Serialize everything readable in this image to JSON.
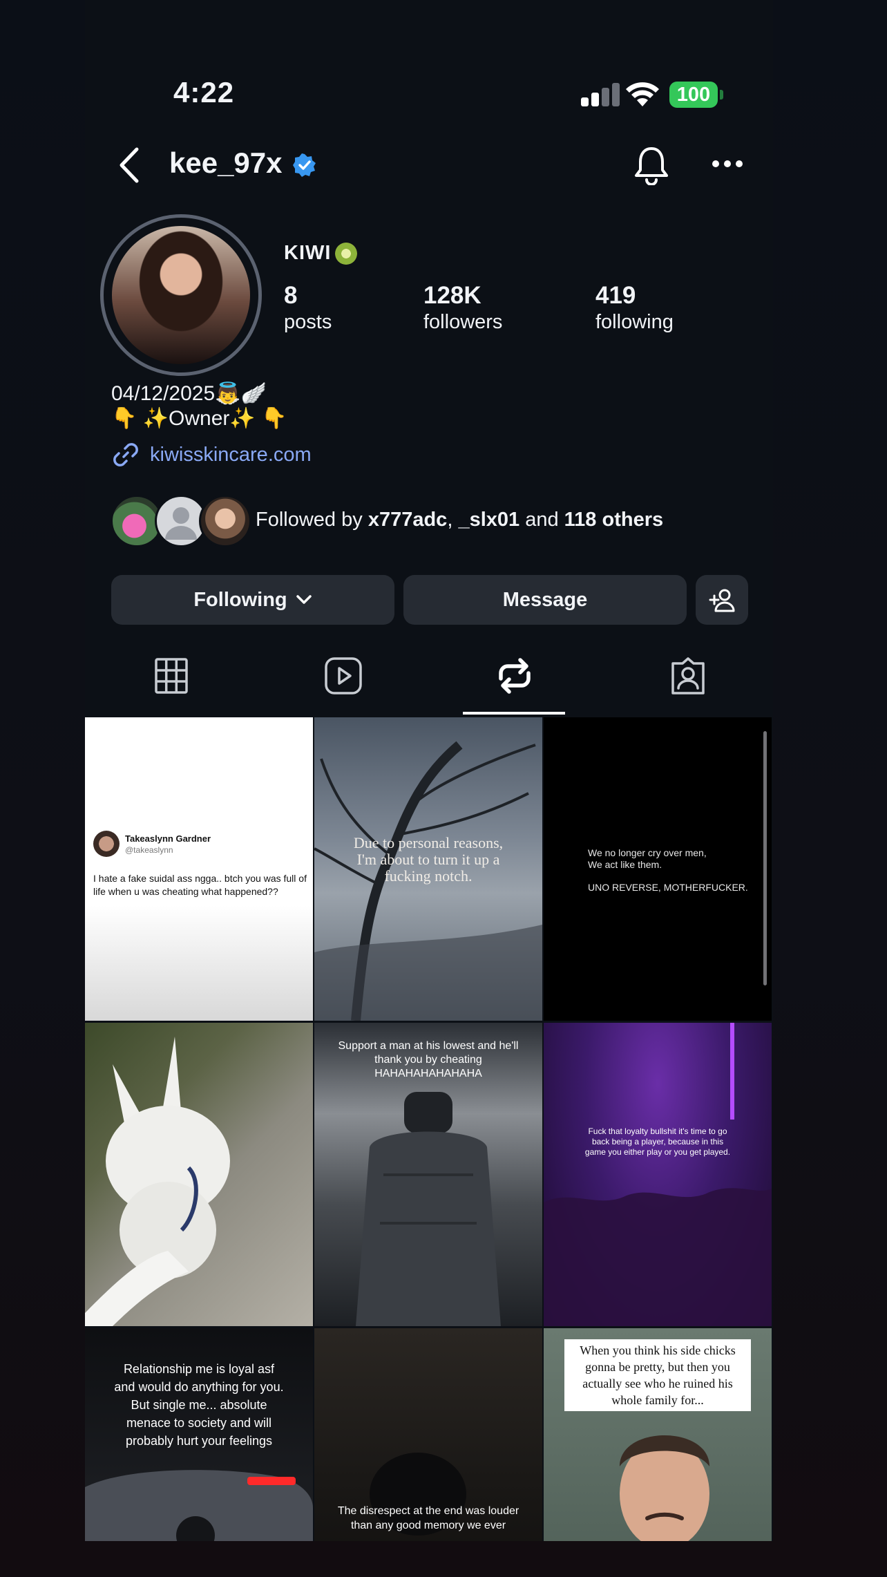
{
  "status_bar": {
    "time": "4:22",
    "battery": "100"
  },
  "header": {
    "username": "kee_97x"
  },
  "profile": {
    "display_name": "KIWI",
    "stats": [
      {
        "value": "8",
        "label": "posts"
      },
      {
        "value": "128K",
        "label": "followers"
      },
      {
        "value": "419",
        "label": "following"
      }
    ],
    "bio_line1": "04/12/2025👼🪽",
    "bio_line2": "👇 ✨Owner✨ 👇",
    "link": "kiwisskincare.com"
  },
  "followed_by": {
    "prefix": "Followed by ",
    "user1": "x777adc",
    "sep": ", ",
    "user2": "_slx01",
    "and": " and ",
    "others": "118 others"
  },
  "actions": {
    "following": "Following",
    "message": "Message"
  },
  "tabs": [
    {
      "icon": "grid-icon",
      "active": false
    },
    {
      "icon": "reels-icon",
      "active": false
    },
    {
      "icon": "reposts-icon",
      "active": true
    },
    {
      "icon": "tagged-icon",
      "active": false
    }
  ],
  "posts": [
    {
      "tweet_name": "Takeaslynn Gardner",
      "tweet_handle": "@takeaslynn",
      "tweet_text": "I hate a fake suidal ass ngga.. btch you was full of life when u was cheating what happened??"
    },
    {
      "caption": "Due to personal reasons, I'm about to turn it up a fucking notch."
    },
    {
      "caption_line1": "We no longer cry over men,",
      "caption_line2": "We act like them.",
      "caption_line3": "UNO REVERSE, MOTHERFUCKER."
    },
    {
      "caption": ""
    },
    {
      "caption": "Support a man at his lowest and he'll thank you by cheating HAHAHAHAHAHAHA"
    },
    {
      "caption": "Fuck that loyalty bullshit it's time to go back being a player, because in this game you either play or you get played."
    },
    {
      "caption": "Relationship me is loyal asf and would do anything for you. But single me... absolute menace to society and will probably hurt your feelings"
    },
    {
      "caption": "The disrespect at the end was louder than any good memory we ever"
    },
    {
      "caption": "When you think his side chicks gonna be pretty, but then you actually see who he ruined his whole family for..."
    }
  ],
  "colors": {
    "accent_link": "#8aa9f5",
    "verified": "#3897f0",
    "battery": "#34c759",
    "button_bg": "#262b33"
  }
}
